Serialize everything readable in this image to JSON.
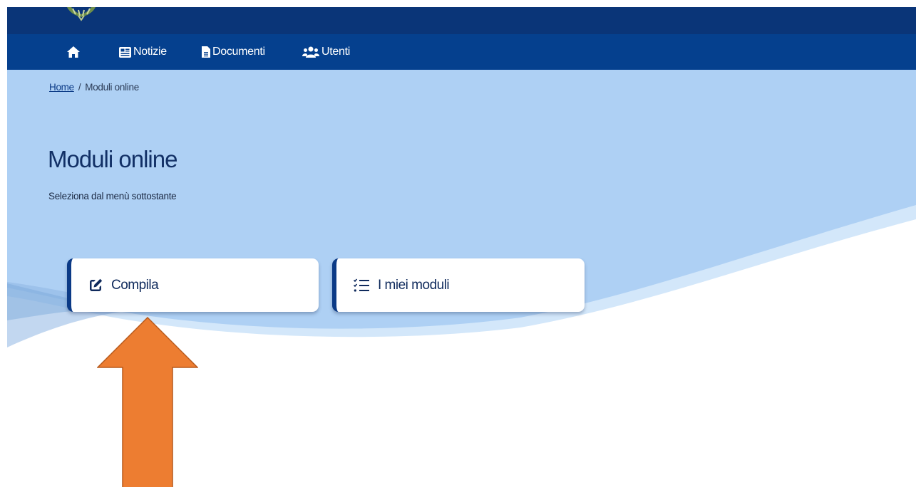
{
  "nav": {
    "items": [
      {
        "id": "home",
        "label": ""
      },
      {
        "id": "notizie",
        "label": "Notizie"
      },
      {
        "id": "documenti",
        "label": "Documenti"
      },
      {
        "id": "utenti",
        "label": "Utenti"
      }
    ]
  },
  "breadcrumb": {
    "home": "Home",
    "separator": "/",
    "current": "Moduli online"
  },
  "page": {
    "title": "Moduli online",
    "subtitle": "Seleziona dal menù sottostante"
  },
  "cards": [
    {
      "label": "Compila",
      "icon": "edit-icon"
    },
    {
      "label": "I miei moduli",
      "icon": "checklist-icon"
    }
  ],
  "annotation": {
    "icon": "arrow-up-icon",
    "color": "#ed7d31"
  },
  "colors": {
    "top_bar": "#0a3578",
    "nav_bar": "#05408e",
    "hero_bg": "#aed0f4",
    "accent": "#0b3a86",
    "arrow": "#ed7d31"
  }
}
